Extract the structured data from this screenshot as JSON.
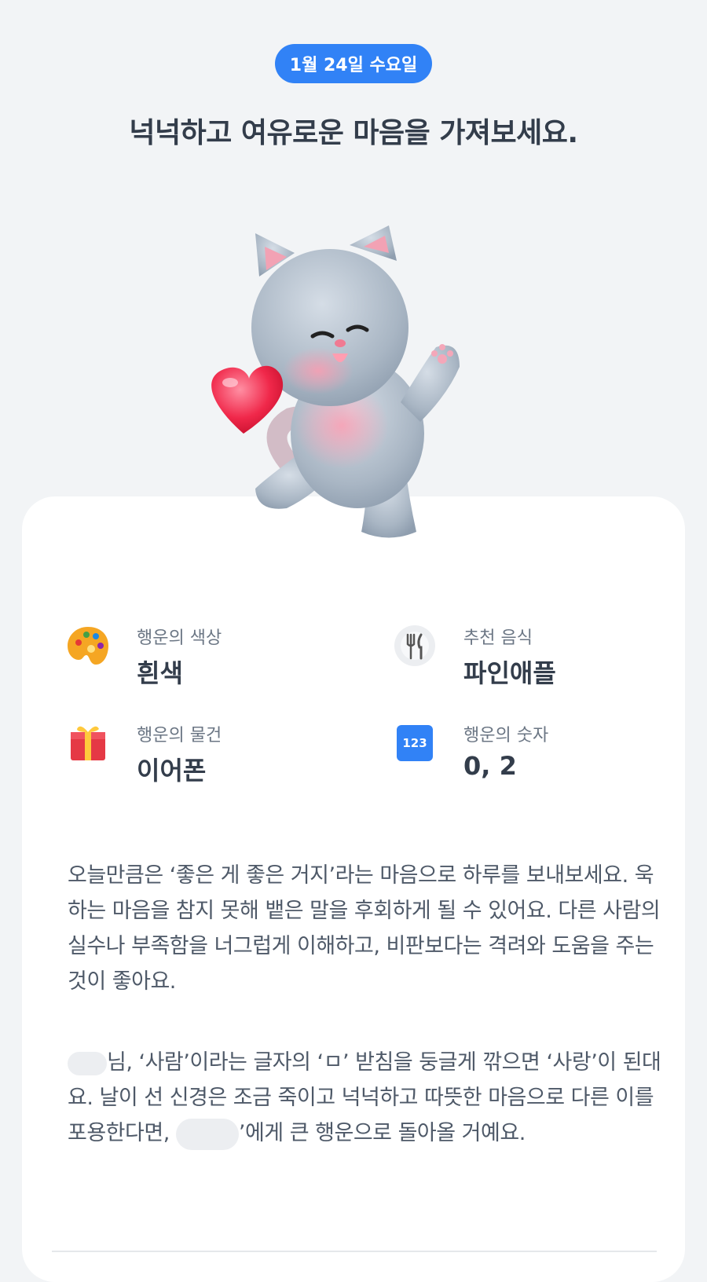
{
  "date_pill": "1월 24일 수요일",
  "headline": "넉넉하고 여유로운 마음을 가져보세요.",
  "mascot": {
    "icon": "cat-with-heart-icon"
  },
  "info": [
    {
      "label": "행운의 색상",
      "value": "흰색",
      "icon": "palette-icon"
    },
    {
      "label": "추천 음식",
      "value": "파인애플",
      "icon": "fork-knife-icon"
    },
    {
      "label": "행운의 물건",
      "value": "이어폰",
      "icon": "gift-box-icon"
    },
    {
      "label": "행운의 숫자",
      "value": "0, 2",
      "icon": "number-123-icon",
      "icon_text": "123"
    }
  ],
  "paragraph1": "오늘만큼은 ‘좋은 게 좋은 거지’라는 마음으로 하루를 보내보세요. 욱하는 마음을 참지 못해 뱉은 말을 후회하게 될 수 있어요. 다른 사람의 실수나 부족함을 너그럽게 이해하고, 비판보다는 격려와 도움을 주는 것이 좋아요.",
  "paragraph2": {
    "part1": "님, ‘사람’이라는 글자의 ‘ㅁ’ 받침을 둥글게 깎으면 ‘사랑’이 된대요. 날이 선 신경은 조금 죽이고 넉넉하고 따뜻한 마음으로 다른 이를 포용한다면, ",
    "part2": "’에게 큰 행운으로 돌아올 거예요."
  },
  "colors": {
    "accent": "#3182f6",
    "background": "#f2f4f6",
    "card": "#ffffff"
  }
}
